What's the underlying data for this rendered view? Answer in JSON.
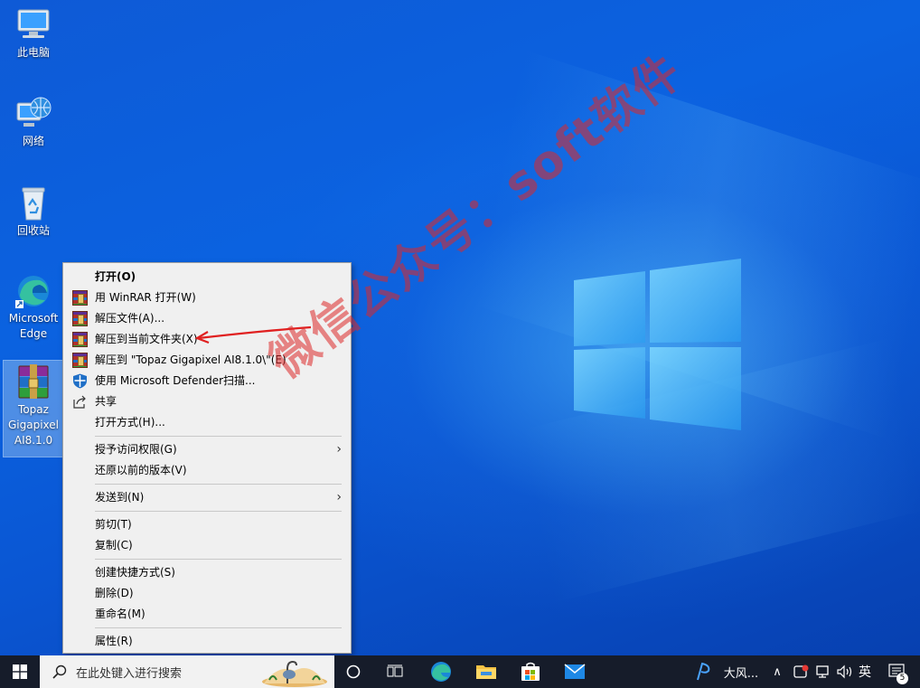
{
  "desktop": {
    "icons": [
      {
        "label": "此电脑",
        "icon": "computer-icon"
      },
      {
        "label": "网络",
        "icon": "network-icon"
      },
      {
        "label": "回收站",
        "icon": "recycle-bin-icon"
      },
      {
        "label": "Microsoft Edge",
        "icon": "edge-icon"
      },
      {
        "label": "Topaz Gigapixel AI8.1.0",
        "icon": "winrar-archive-icon"
      }
    ]
  },
  "context_menu": {
    "items": [
      {
        "label": "打开(O)",
        "bold": true
      },
      {
        "label": "用 WinRAR 打开(W)",
        "icon": "winrar-icon"
      },
      {
        "label": "解压文件(A)...",
        "icon": "winrar-icon"
      },
      {
        "label": "解压到当前文件夹(X)",
        "icon": "winrar-icon"
      },
      {
        "label": "解压到 \"Topaz Gigapixel AI8.1.0\\\"(E)",
        "icon": "winrar-icon"
      },
      {
        "label": "使用 Microsoft Defender扫描...",
        "icon": "defender-shield-icon"
      },
      {
        "label": "共享",
        "icon": "share-icon"
      },
      {
        "label": "打开方式(H)..."
      },
      {
        "label": "授予访问权限(G)",
        "submenu": true
      },
      {
        "label": "还原以前的版本(V)"
      },
      {
        "label": "发送到(N)",
        "submenu": true
      },
      {
        "label": "剪切(T)"
      },
      {
        "label": "复制(C)"
      },
      {
        "label": "创建快捷方式(S)"
      },
      {
        "label": "删除(D)"
      },
      {
        "label": "重命名(M)"
      },
      {
        "label": "属性(R)"
      }
    ]
  },
  "watermark": "微信公众号：soft软件",
  "taskbar": {
    "search_placeholder": "在此处键入进行搜索",
    "tray_app_label": "大风...",
    "ime_label": "英",
    "notification_count": "5",
    "icons": [
      "windows-start-icon",
      "search-icon",
      "cortana-icon",
      "task-view-icon",
      "edge-icon",
      "file-explorer-icon",
      "store-icon",
      "mail-icon"
    ]
  },
  "colors": {
    "wallpaper": "#0b62e0",
    "menu_bg": "#f0f0f0",
    "taskbar_bg": "#161c2a",
    "annotation_red": "#e02020"
  }
}
